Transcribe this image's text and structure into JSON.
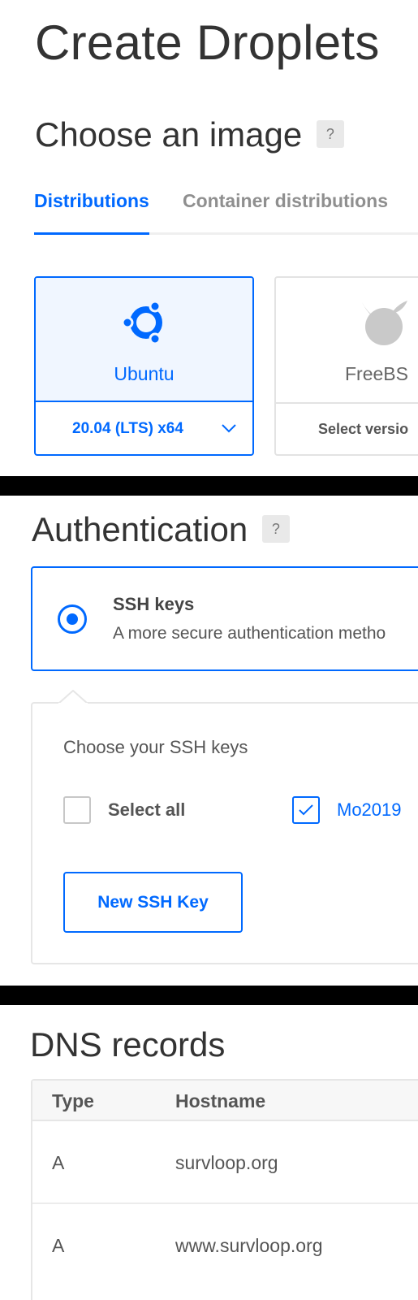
{
  "page": {
    "title": "Create Droplets"
  },
  "image_section": {
    "heading": "Choose an image",
    "help": "?",
    "tabs": [
      {
        "label": "Distributions",
        "active": true
      },
      {
        "label": "Container distributions",
        "active": false
      }
    ],
    "distros": [
      {
        "name": "Ubuntu",
        "version": "20.04 (LTS) x64",
        "selected": true,
        "icon": "ubuntu-logo-icon"
      },
      {
        "name": "FreeBS",
        "version": "Select versio",
        "selected": false,
        "icon": "freebsd-logo-icon"
      }
    ]
  },
  "auth_section": {
    "heading": "Authentication",
    "help": "?",
    "option": {
      "title": "SSH keys",
      "description": "A more secure authentication metho",
      "selected": true
    },
    "keys_panel": {
      "label": "Choose your SSH keys",
      "select_all": "Select all",
      "key_name": "Mo2019",
      "new_key_button": "New SSH Key"
    }
  },
  "dns_section": {
    "heading": "DNS records",
    "columns": [
      "Type",
      "Hostname"
    ],
    "rows": [
      {
        "type": "A",
        "hostname": "survloop.org"
      },
      {
        "type": "A",
        "hostname": "www.survloop.org"
      }
    ]
  },
  "colors": {
    "accent": "#0069ff",
    "selected_bg": "#f0f6ff",
    "text": "#333333",
    "muted": "#777777"
  }
}
